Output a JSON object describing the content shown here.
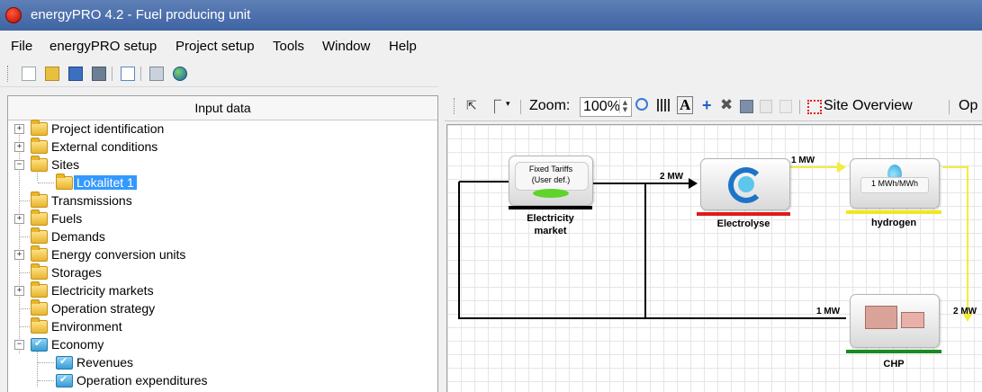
{
  "window": {
    "title": "energyPRO 4.2  -  Fuel producing unit"
  },
  "menu": {
    "items": [
      "File",
      "energyPRO setup",
      "Project setup",
      "Tools",
      "Window",
      "Help"
    ]
  },
  "left_panel": {
    "title": "Input data",
    "tree": [
      {
        "label": "Project identification",
        "expander": "+",
        "icon": "folder-icon"
      },
      {
        "label": "External conditions",
        "expander": "+",
        "icon": "folder-icon"
      },
      {
        "label": "Sites",
        "expander": "−",
        "icon": "folder-icon"
      },
      {
        "label": "Lokalitet 1",
        "icon": "folder-icon",
        "selected": true
      },
      {
        "label": "Transmissions",
        "icon": "folder-icon"
      },
      {
        "label": "Fuels",
        "expander": "+",
        "icon": "folder-icon"
      },
      {
        "label": "Demands",
        "icon": "folder-icon"
      },
      {
        "label": "Energy conversion units",
        "expander": "+",
        "icon": "folder-icon"
      },
      {
        "label": "Storages",
        "icon": "folder-icon"
      },
      {
        "label": "Electricity markets",
        "expander": "+",
        "icon": "folder-icon"
      },
      {
        "label": "Operation strategy",
        "icon": "folder-icon"
      },
      {
        "label": "Environment",
        "icon": "folder-icon"
      },
      {
        "label": "Economy",
        "expander": "−",
        "icon": "checked-folder-icon"
      },
      {
        "label": "Revenues",
        "icon": "checked-folder-icon"
      },
      {
        "label": "Operation expenditures",
        "icon": "checked-folder-icon"
      }
    ]
  },
  "diagram_toolbar": {
    "zoom_label": "Zoom:",
    "zoom_value": "100%",
    "site_overview": "Site Overview",
    "overflow_text": "Op"
  },
  "diagram": {
    "electricity_market": {
      "line1": "Fixed Tariffs",
      "line2": "(User def.)",
      "label_line1": "Electricity",
      "label_line2": "market",
      "bar_color": "#000000"
    },
    "electrolyse": {
      "label": "Electrolyse",
      "bar_color": "#e01b1b"
    },
    "hydrogen": {
      "inner": "1 MWh/MWh",
      "label": "hydrogen",
      "bar_color": "#f0e81a"
    },
    "chp": {
      "label": "CHP",
      "bar_color": "#1a8a22"
    },
    "flows": {
      "market_to_electrolyse": "2 MW",
      "electrolyse_to_hydrogen": "1 MW",
      "hydrogen_to_chp": "2 MW",
      "chp_to_market": "1 MW"
    },
    "colors": {
      "hydrogen_line": "#f2ee3a",
      "electricity_line": "#000000"
    }
  }
}
